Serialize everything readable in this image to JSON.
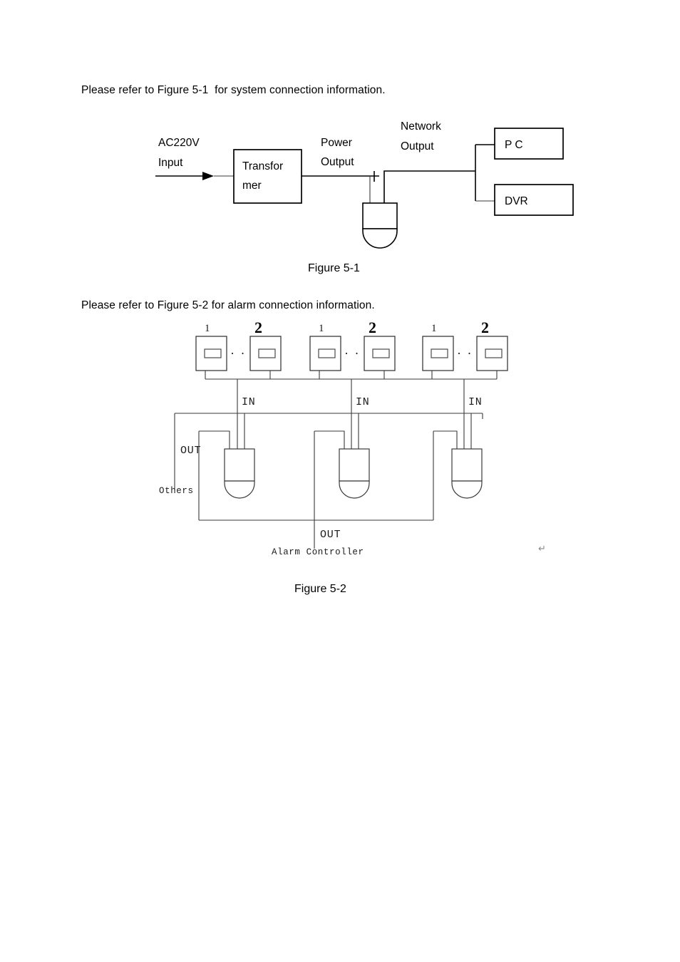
{
  "document": {
    "paragraph_1": "Please refer to Figure 5-1  for system connection information.",
    "paragraph_2": "Please refer to Figure 5-2 for alarm connection information.",
    "caption_1": "Figure 5-1",
    "caption_2": "Figure 5-2",
    "paragraph_mark": "↵"
  },
  "figure_5_1": {
    "title": "Figure 5-1",
    "nodes": {
      "ac_input_label_line1": "AC220V",
      "ac_input_label_line2": "Input",
      "transformer_line1": "Transfor",
      "transformer_line2": "mer",
      "power_output_line1": "Power",
      "power_output_line2": "Output",
      "network_output_line1": "Network",
      "network_output_line2": "Output",
      "pc_label": "P C",
      "dvr_label": "DVR"
    }
  },
  "figure_5_2": {
    "title": "Figure 5-2",
    "groups": [
      {
        "sensor_first": "1",
        "sensor_last": "2",
        "ellipsis": "· · ·",
        "in_label": "IN"
      },
      {
        "sensor_first": "1",
        "sensor_last": "2",
        "ellipsis": "· · ·",
        "in_label": "IN"
      },
      {
        "sensor_first": "1",
        "sensor_last": "2",
        "ellipsis": "· · ·",
        "in_label": "IN"
      }
    ],
    "labels": {
      "out_left": "OUT",
      "others": "Others",
      "out_bottom": "OUT",
      "alarm_controller": "Alarm Controller"
    }
  }
}
